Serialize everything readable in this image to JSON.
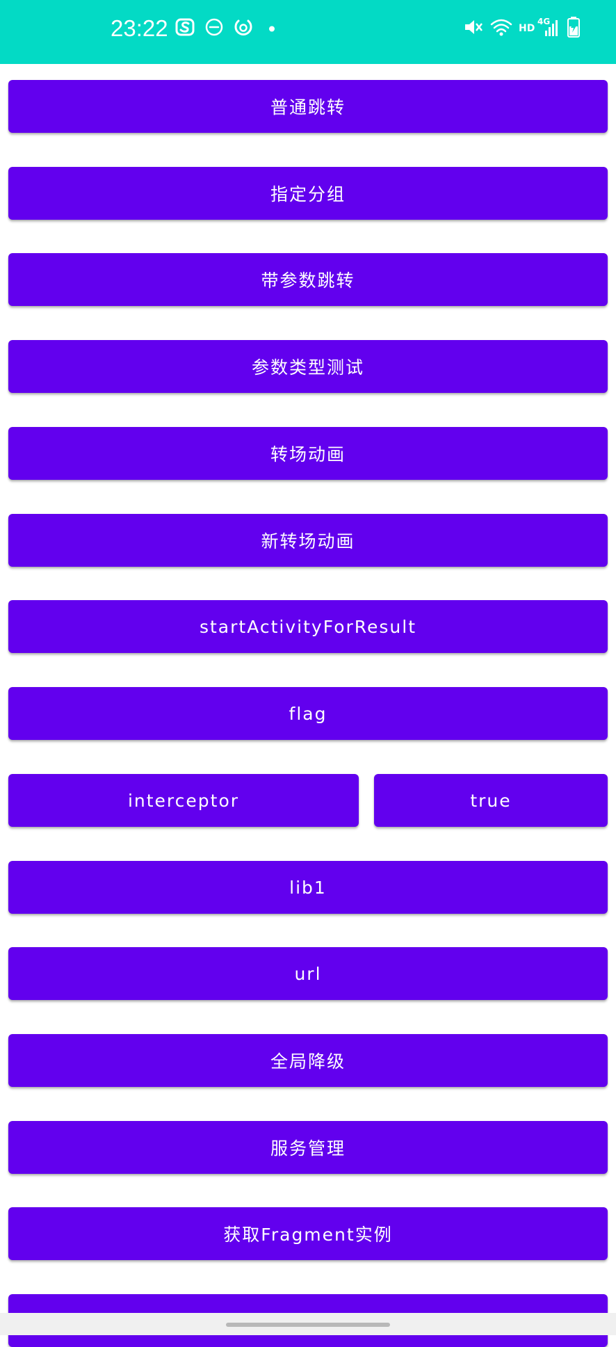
{
  "status_bar": {
    "time": "23:22",
    "network_label": "HD",
    "network_type": "4G",
    "icons": [
      "weibo-icon",
      "dnd-icon",
      "sync-icon",
      "dot-icon",
      "mute-icon",
      "wifi-icon",
      "signal-icon",
      "battery-icon"
    ],
    "background_color": "#03DAC5"
  },
  "buttons": {
    "normal_jump": "普通跳转",
    "specify_group": "指定分组",
    "jump_with_params": "带参数跳转",
    "param_type_test": "参数类型测试",
    "transition_anim": "转场动画",
    "new_transition_anim": "新转场动画",
    "start_activity_for_result": "startActivityForResult",
    "flag": "flag",
    "interceptor": "interceptor",
    "interceptor_toggle": "true",
    "lib1": "lib1",
    "url": "url",
    "global_degrade": "全局降级",
    "service_management": "服务管理",
    "get_fragment_instance": "获取Fragment实例"
  },
  "colors": {
    "button_background": "#6200EE",
    "button_text": "#FFFFFF"
  }
}
